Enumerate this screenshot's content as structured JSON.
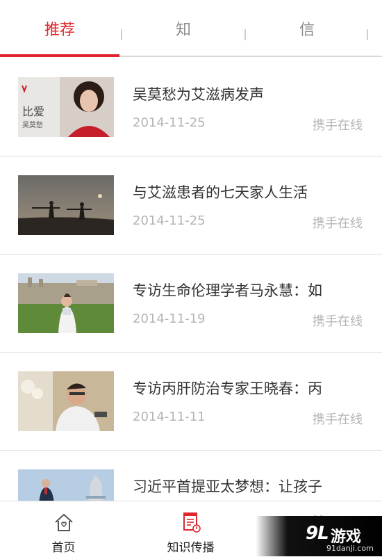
{
  "tabs": [
    {
      "label": "推荐"
    },
    {
      "label": "知"
    },
    {
      "label": "信"
    }
  ],
  "colors": {
    "accent": "#e0262c",
    "text": "#333333",
    "meta": "#b5b5b5"
  },
  "articles": [
    {
      "title": "吴莫愁为艾滋病发声",
      "date": "2014-11-25",
      "source": "携手在线"
    },
    {
      "title": "与艾滋患者的七天家人生活",
      "date": "2014-11-25",
      "source": "携手在线"
    },
    {
      "title": "专访生命伦理学者马永慧：如",
      "date": "2014-11-19",
      "source": "携手在线"
    },
    {
      "title": "专访丙肝防治专家王晓春：丙",
      "date": "2014-11-11",
      "source": "携手在线"
    },
    {
      "title": "习近平首提亚太梦想：让孩子",
      "date": "",
      "source": ""
    }
  ],
  "bottom_nav": [
    {
      "label": "首页",
      "icon": "home-icon"
    },
    {
      "label": "知识传播",
      "icon": "document-icon"
    },
    {
      "label": "",
      "icon": "heart-icon"
    }
  ],
  "watermark": {
    "logo": "9L",
    "text": "游戏",
    "domain": "91danji.com"
  }
}
